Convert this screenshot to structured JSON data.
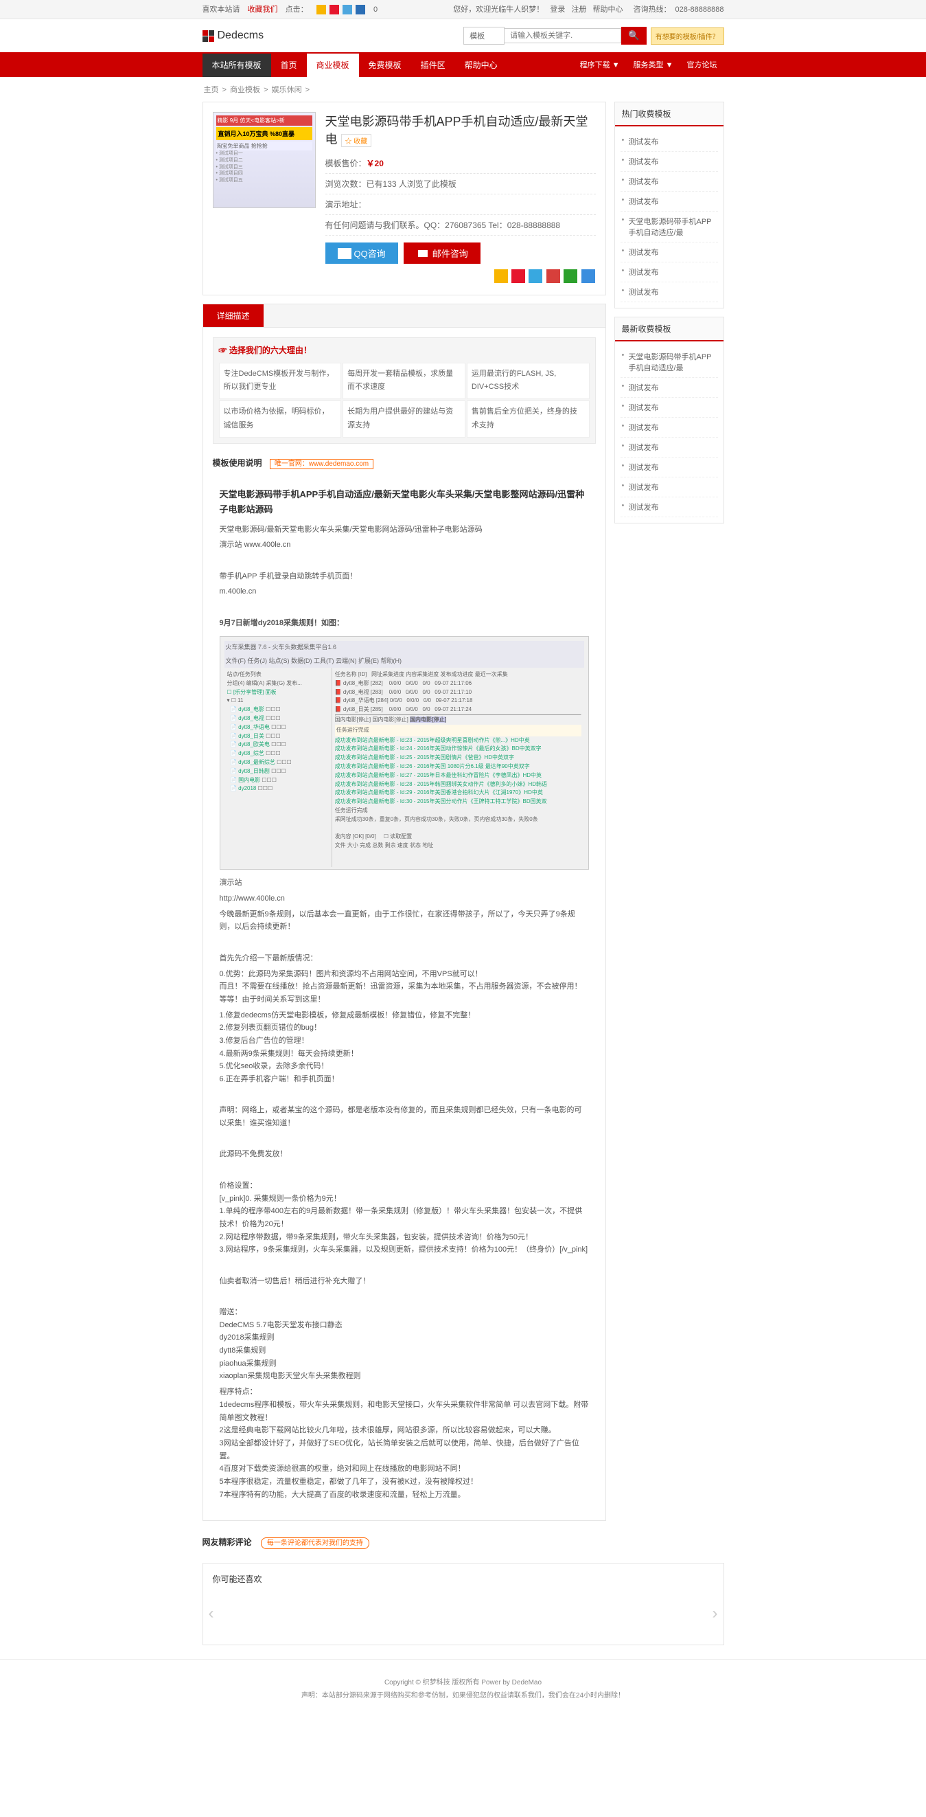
{
  "topbar": {
    "left": {
      "fav": "喜欢本站请",
      "favbtn": "收藏我们",
      "click": "点击：",
      "count": "0"
    },
    "right": {
      "welcome": "您好，欢迎光临牛人织梦！",
      "login": "登录",
      "register": "注册",
      "help": "帮助中心",
      "hotline_lbl": "咨询热线：",
      "hotline": "028-88888888"
    }
  },
  "logo": "Dedecms",
  "search": {
    "category": "模板",
    "placeholder": "请输入模板关键字.",
    "adtext": "有想要的模板/插件？"
  },
  "nav": {
    "main": [
      "本站所有模板",
      "首页",
      "商业模板",
      "免费模板",
      "插件区",
      "帮助中心"
    ],
    "right": [
      "程序下载 ▼",
      "服务类型 ▼",
      "官方论坛"
    ]
  },
  "breadcrumb": [
    "主页",
    "商业模板",
    "娱乐休闲"
  ],
  "product": {
    "title": "天堂电影源码带手机APP手机自动适应/最新天堂电",
    "fav": "☆ 收藏",
    "price_lbl": "模板售价：",
    "price": "￥20",
    "views_lbl": "浏览次数：",
    "views": "已有133 人浏览了此模板",
    "demo_lbl": "演示地址：",
    "contact": "有任何问题请与我们联系。QQ：276087365 Tel：028-88888888",
    "qq_btn": "QQ咨询",
    "mail_btn": "邮件咨询"
  },
  "tab": "详细描述",
  "reasons": {
    "title": "☞ 选择我们的六大理由！",
    "items": [
      "专注DedeCMS模板开发与制作，所以我们更专业",
      "每周开发一套精品模板，求质量而不求速度",
      "运用最流行的FLASH, JS, DIV+CSS技术",
      "以市场价格为依据，明码标价，诚信服务",
      "长期为用户提供最好的建站与资源支持",
      "售前售后全方位把关，终身的技术支持"
    ]
  },
  "usage": {
    "lbl": "模板使用说明",
    "tag": "唯一官网：www.dedemao.com"
  },
  "article": {
    "h1": "天堂电影源码带手机APP手机自动适应/最新天堂电影火车头采集/天堂电影整网站源码/迅雷种子电影站源码",
    "sub": "天堂电影源码/最新天堂电影火车头采集/天堂电影网站源码/迅雷种子电影站源码",
    "demo": "演示站  www.400le.cn",
    "app": "带手机APP  手机登录自动跳转手机页面！",
    "appurl": "m.400le.cn",
    "rule": "9月7日新增dy2018采集规则！如图：",
    "body_demo": "演示站",
    "body_url": "http://www.400le.cn",
    "body_p1": "今晚最新更新9条规则，以后基本会一直更新，由于工作很忙，在家还得带孩子，所以了，今天只弄了9条规则，以后会持续更新！",
    "body_p2": "首先先介绍一下最新版情况：",
    "body_p3": "0.优势：此源码为采集源码！图片和资源均不占用网站空间，不用VPS就可以！\n    而且！不需要在线播放！抢占资源最新更新！迅雷资源，采集为本地采集，不占用服务器资源，不会被停用！等等！由于时间关系写到这里！",
    "body_p4": "1.修复dedecms仿天堂电影模板，修复成最新模板！修复错位，修复不完整！\n2.修复列表页翻页错位的bug！\n3.修复后台广告位的管理！\n4.最新两9条采集规则！每天会持续更新！\n5.优化seo收录，去除多余代码！\n6.正在弄手机客户端！和手机页面！",
    "body_p5": "声明：网络上，或者某宝的这个源码，都是老版本没有修复的，而且采集规则都已经失效，只有一条电影的可以采集！谁买谁知道！",
    "body_p6": "此源码不免费发放！",
    "body_p7": "价格设置：\n[v_pink]0. 采集规则一条价格为9元！\n1.单纯的程序带400左右的9月最新数据！带一条采集规则（修复版）！带火车头采集器！包安装一次，不提供技术！价格为20元！\n2.网站程序带数据，带9条采集规则，带火车头采集器，包安装，提供技术咨询！价格为50元！\n3.网站程序，9条采集规则，火车头采集器，以及规则更新，提供技术支持！价格为100元！（终身价）[/v_pink]",
    "body_p8": "仙卖者取消一切售后！稍后进行补充大赠了！",
    "body_p9": "赠送：\nDedeCMS 5.7电影天堂发布接口静态\ndy2018采集规则\ndytt8采集规则\npiaohua采集规则\nxiaoplan采集规电影天堂火车头采集教程则",
    "body_p10": "程序特点：\n1dedecms程序和模板，带火车头采集规则，和电影天堂接口，火车头采集软件非常简单 可以去官网下载。附带简单图文教程！\n2这是经典电影下载网站比较火几年啦，技术很雄厚，网站很多源，所以比较容易做起来，可以大赚。\n3网站全部都设计好了，并做好了SEO优化，站长简单安装之后就可以使用，简单、快捷，后台做好了广告位置。\n4百度对下载类资源给很高的权重，绝对和网上在线播放的电影网站不同！\n5本程序很稳定，流量权重稳定，都做了几年了，没有被K过，没有被降权过！\n7本程序特有的功能，大大提高了百度的收录速度和流量，轻松上万流量。"
  },
  "comment": {
    "title": "网友精彩评论",
    "tag": "每一条评论都代表对我们的支持"
  },
  "related": "你可能还喜欢",
  "sidebar": {
    "hot": {
      "title": "热门收费模板",
      "items": [
        "测试发布",
        "测试发布",
        "测试发布",
        "测试发布",
        "天堂电影源码带手机APP手机自动适应/最",
        "测试发布",
        "测试发布",
        "测试发布"
      ]
    },
    "new": {
      "title": "最新收费模板",
      "items": [
        "天堂电影源码带手机APP手机自动适应/最",
        "测试发布",
        "测试发布",
        "测试发布",
        "测试发布",
        "测试发布",
        "测试发布",
        "测试发布"
      ]
    }
  },
  "footer": {
    "copy": "Copyright © 织梦科技  版权所有 Power by DedeMao",
    "note": "声明：本站部分源码来源于网络购买和参考仿制，如果侵犯您的权益请联系我们，我们会在24小时内删除！"
  }
}
